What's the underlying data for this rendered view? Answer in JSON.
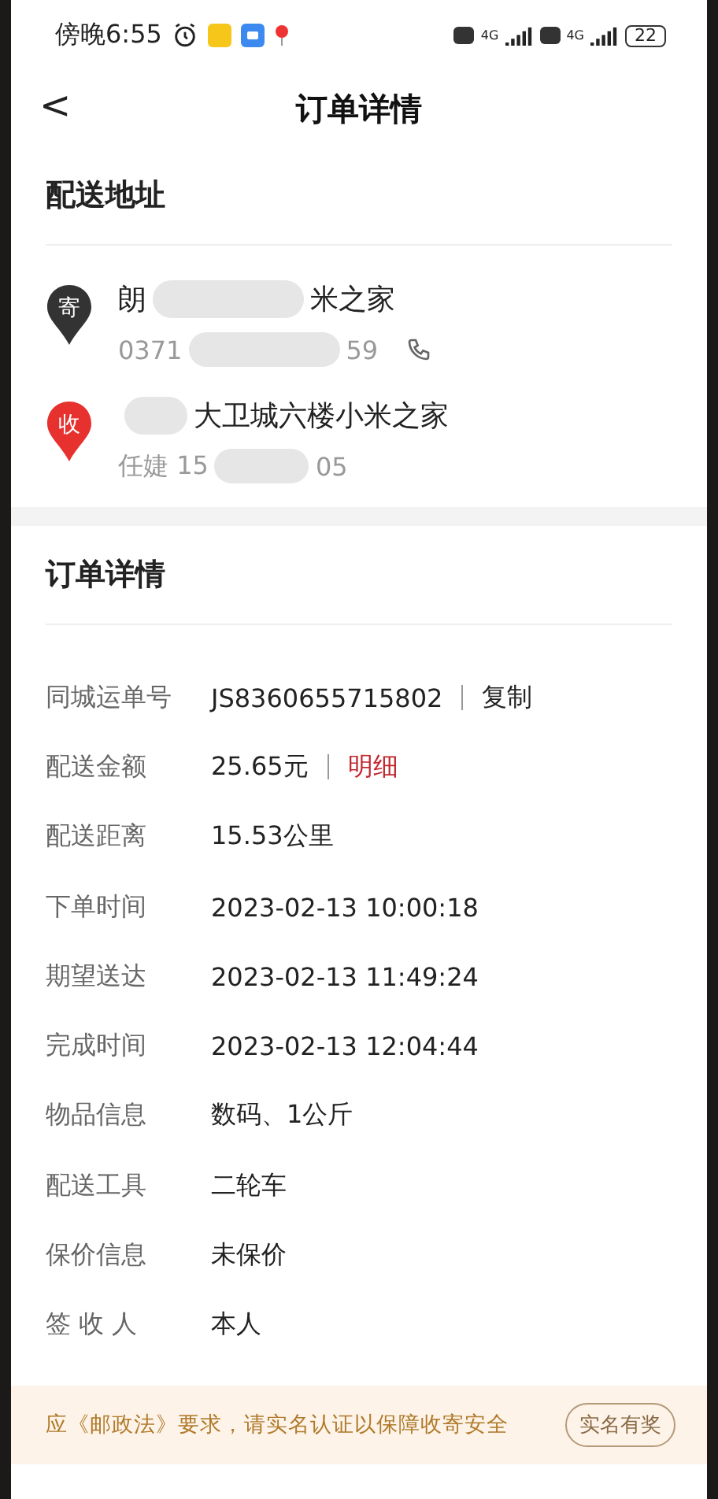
{
  "status_bar": {
    "time": "傍晚6:55",
    "battery": "22",
    "network_1": "4G",
    "network_2": "4G"
  },
  "header": {
    "back": "<",
    "title": "订单详情"
  },
  "address_section": {
    "title": "配送地址",
    "entries": [
      {
        "kind": "sender",
        "badge": "寄",
        "line_1": [
          "朗",
          "米之家"
        ],
        "line_2": [
          "0371",
          "59"
        ],
        "call": true
      },
      {
        "kind": "receiver",
        "badge": "收",
        "line_1": [
          "大卫城六楼小米之家"
        ],
        "line_2": [
          "任婕  15",
          "05"
        ],
        "call": false
      }
    ]
  },
  "details_section": {
    "title": "订单详情",
    "rows": [
      {
        "label": "同城运单号",
        "value": "JS8360655715802",
        "action": {
          "label": "复制",
          "emphasized": false
        }
      },
      {
        "label": "配送金额",
        "value": "25.65元",
        "action": {
          "label": "明细",
          "emphasized": true
        }
      },
      {
        "label": "配送距离",
        "value": "15.53公里"
      },
      {
        "label": "下单时间",
        "value": "2023-02-13 10:00:18"
      },
      {
        "label": "期望送达",
        "value": "2023-02-13 11:49:24"
      },
      {
        "label": "完成时间",
        "value": "2023-02-13 12:04:44"
      },
      {
        "label": "物品信息",
        "value": "数码、1公斤"
      },
      {
        "label": "配送工具",
        "value": "二轮车"
      },
      {
        "label": "保价信息",
        "value": "未保价"
      },
      {
        "label": "签 收 人",
        "value": "本人"
      }
    ]
  },
  "notice": {
    "text": "应《邮政法》要求，请实名认证以保障收寄安全",
    "button": "实名有奖"
  }
}
